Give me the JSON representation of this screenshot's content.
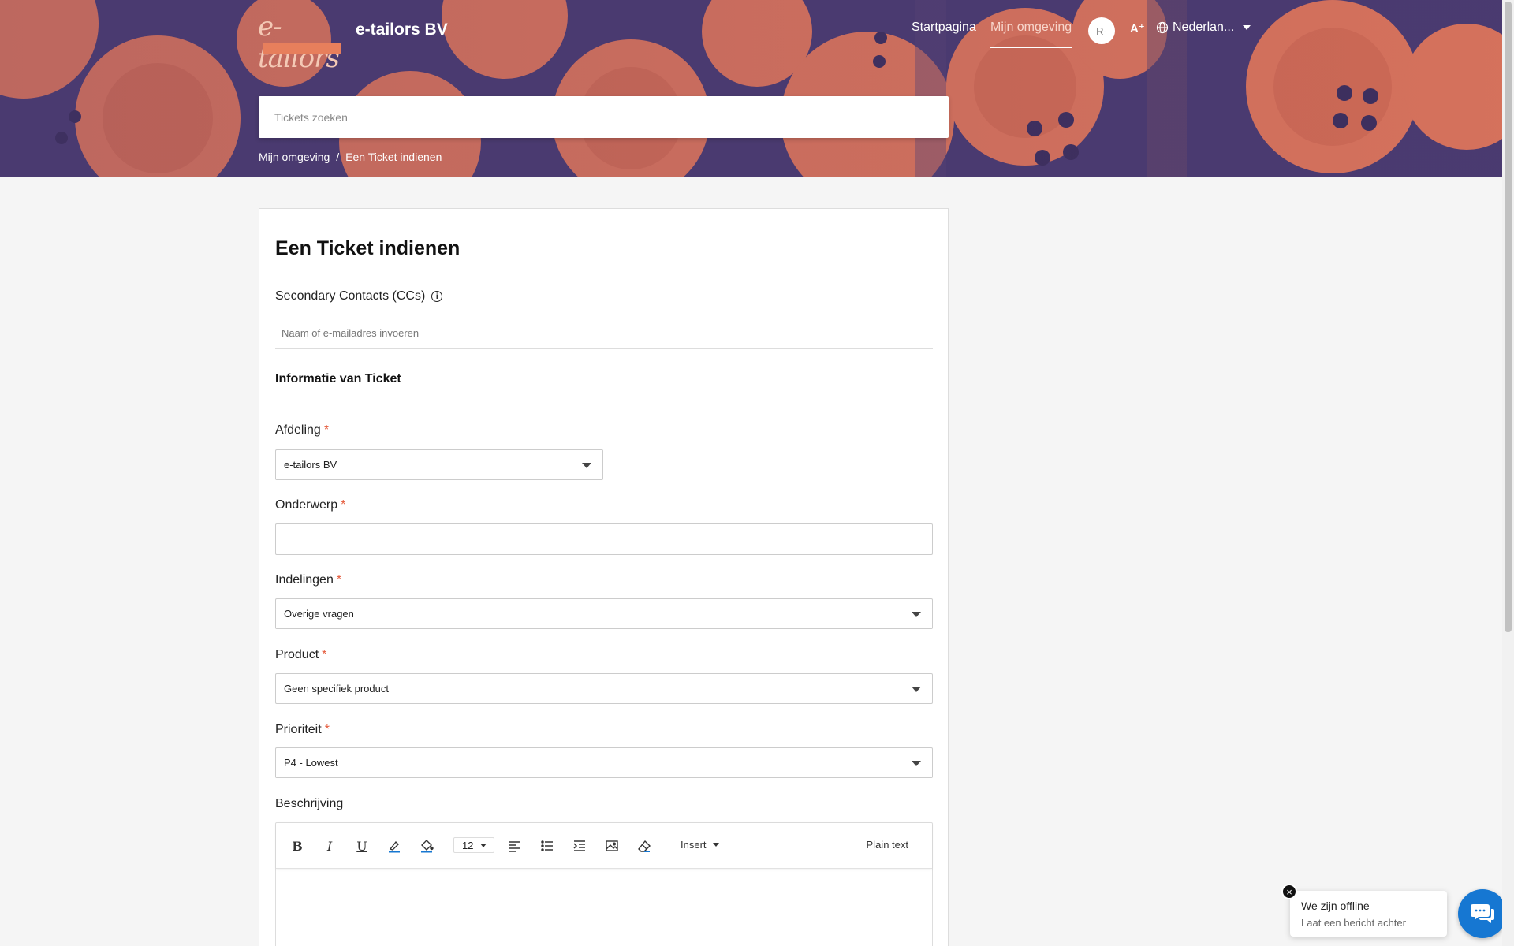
{
  "header": {
    "logo_text": "e-tailors",
    "brand_name": "e-tailors BV",
    "nav": {
      "home": "Startpagina",
      "my_env": "Mijn omgeving"
    },
    "avatar_initials": "R-",
    "font_size_icon": "A⁺",
    "language": "Nederlan...",
    "accent_color": "#e77f5c"
  },
  "search": {
    "placeholder": "Tickets zoeken"
  },
  "breadcrumb": {
    "items": [
      "Mijn omgeving",
      "Een Ticket indienen"
    ],
    "separator": "/"
  },
  "form": {
    "title": "Een Ticket indienen",
    "cc_label": "Secondary Contacts (CCs)",
    "cc_placeholder": "Naam of e-mailadres invoeren",
    "section_title": "Informatie van Ticket",
    "required_mark": "*",
    "department": {
      "label": "Afdeling",
      "value": "e-tailors BV"
    },
    "subject": {
      "label": "Onderwerp",
      "value": ""
    },
    "classification": {
      "label": "Indelingen",
      "value": "Overige vragen"
    },
    "product": {
      "label": "Product",
      "value": "Geen specifiek product"
    },
    "priority": {
      "label": "Prioriteit",
      "value": "P4 - Lowest"
    },
    "description": {
      "label": "Beschrijving",
      "toolbar": {
        "bold": "B",
        "italic": "I",
        "underline": "U",
        "font_size": "12",
        "insert": "Insert",
        "plain_text": "Plain text"
      }
    }
  },
  "chat": {
    "title": "We zijn offline",
    "subtitle": "Laat een bericht achter",
    "close": "×",
    "button_color": "#1677d2"
  }
}
